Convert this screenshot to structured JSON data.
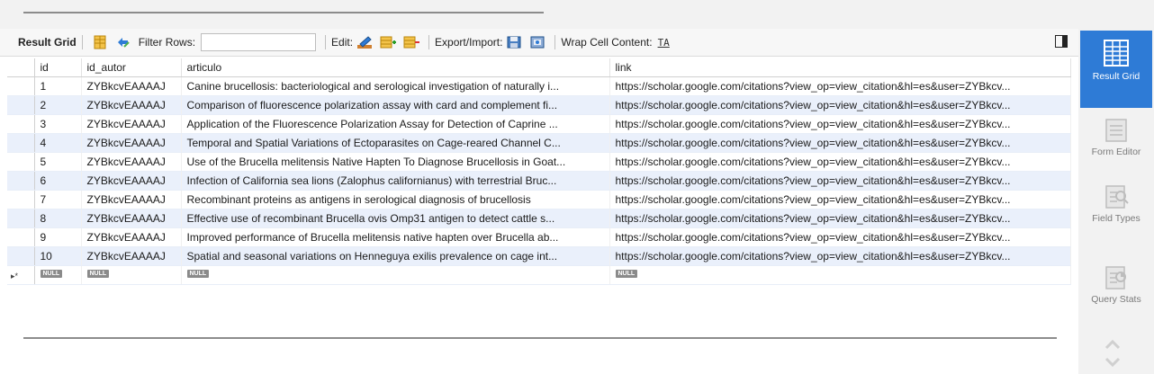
{
  "toolbar": {
    "result_grid_label": "Result Grid",
    "filter_rows_label": "Filter Rows:",
    "filter_value": "",
    "edit_label": "Edit:",
    "export_import_label": "Export/Import:",
    "wrap_cell_label": "Wrap Cell Content:",
    "wrap_icon_text": "TA"
  },
  "grid": {
    "columns": [
      "id",
      "id_autor",
      "articulo",
      "link"
    ],
    "rows": [
      {
        "id": "1",
        "id_autor": "ZYBkcvEAAAAJ",
        "articulo": "Canine brucellosis: bacteriological and serological investigation of naturally i...",
        "link": "https://scholar.google.com/citations?view_op=view_citation&hl=es&user=ZYBkcv..."
      },
      {
        "id": "2",
        "id_autor": "ZYBkcvEAAAAJ",
        "articulo": "Comparison of fluorescence polarization assay with card and complement fi...",
        "link": "https://scholar.google.com/citations?view_op=view_citation&hl=es&user=ZYBkcv..."
      },
      {
        "id": "3",
        "id_autor": "ZYBkcvEAAAAJ",
        "articulo": "Application of the Fluorescence Polarization Assay for Detection of Caprine ...",
        "link": "https://scholar.google.com/citations?view_op=view_citation&hl=es&user=ZYBkcv..."
      },
      {
        "id": "4",
        "id_autor": "ZYBkcvEAAAAJ",
        "articulo": "Temporal and Spatial Variations of Ectoparasites on Cage-reared Channel C...",
        "link": "https://scholar.google.com/citations?view_op=view_citation&hl=es&user=ZYBkcv..."
      },
      {
        "id": "5",
        "id_autor": "ZYBkcvEAAAAJ",
        "articulo": "Use of the Brucella melitensis Native Hapten To Diagnose Brucellosis in Goat...",
        "link": "https://scholar.google.com/citations?view_op=view_citation&hl=es&user=ZYBkcv..."
      },
      {
        "id": "6",
        "id_autor": "ZYBkcvEAAAAJ",
        "articulo": "Infection of California sea lions (Zalophus californianus) with terrestrial Bruc...",
        "link": "https://scholar.google.com/citations?view_op=view_citation&hl=es&user=ZYBkcv..."
      },
      {
        "id": "7",
        "id_autor": "ZYBkcvEAAAAJ",
        "articulo": "Recombinant proteins as antigens in serological diagnosis of brucellosis",
        "link": "https://scholar.google.com/citations?view_op=view_citation&hl=es&user=ZYBkcv..."
      },
      {
        "id": "8",
        "id_autor": "ZYBkcvEAAAAJ",
        "articulo": "Effective use of recombinant Brucella ovis Omp31 antigen to detect cattle s...",
        "link": "https://scholar.google.com/citations?view_op=view_citation&hl=es&user=ZYBkcv..."
      },
      {
        "id": "9",
        "id_autor": "ZYBkcvEAAAAJ",
        "articulo": "Improved performance of Brucella melitensis native hapten over Brucella ab...",
        "link": "https://scholar.google.com/citations?view_op=view_citation&hl=es&user=ZYBkcv..."
      },
      {
        "id": "10",
        "id_autor": "ZYBkcvEAAAAJ",
        "articulo": "Spatial and seasonal variations on Henneguya exilis prevalence on cage int...",
        "link": "https://scholar.google.com/citations?view_op=view_citation&hl=es&user=ZYBkcv..."
      }
    ],
    "null_badge": "NULL",
    "new_row_marker": "▸*"
  },
  "side_panel": {
    "items": [
      {
        "label": "Result Grid",
        "state": "active",
        "icon": "grid-icon"
      },
      {
        "label": "Form Editor",
        "state": "inactive",
        "icon": "form-icon"
      },
      {
        "label": "Field Types",
        "state": "inactive",
        "icon": "field-types-icon"
      },
      {
        "label": "Query Stats",
        "state": "inactive",
        "icon": "query-stats-icon"
      }
    ]
  },
  "colors": {
    "accent": "#2e7bd6",
    "row_alt": "#eaf0fb",
    "null_badge": "#8a8a8a"
  }
}
